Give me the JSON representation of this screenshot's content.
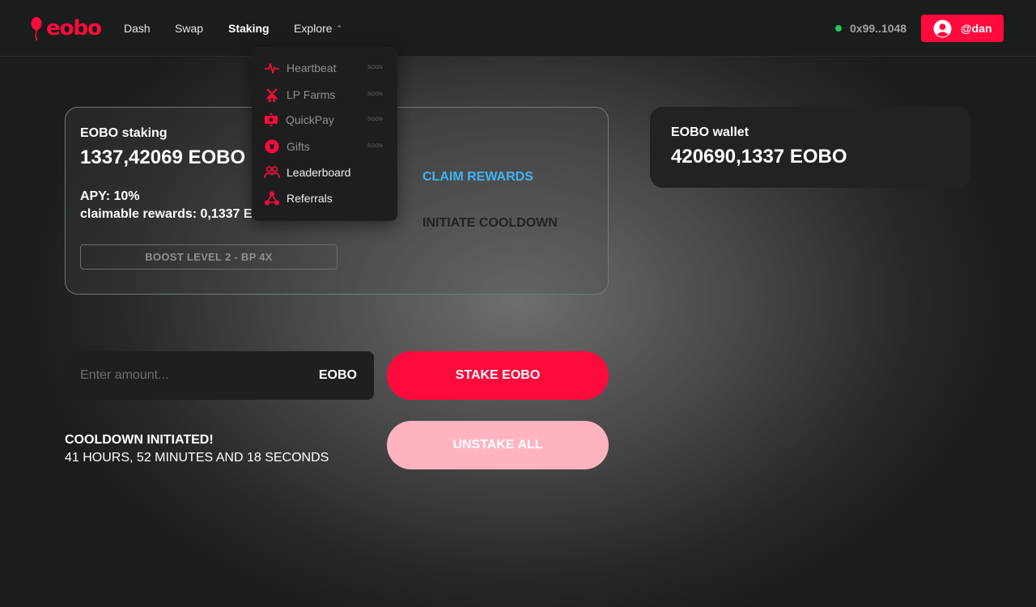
{
  "header": {
    "logo_text": "eobo",
    "nav": [
      {
        "label": "Dash",
        "active": false
      },
      {
        "label": "Swap",
        "active": false
      },
      {
        "label": "Staking",
        "active": true
      },
      {
        "label": "Explore",
        "active": false
      }
    ],
    "wallet_address": "0x99..1048",
    "connection_status_color": "#22c55e",
    "username": "@dan"
  },
  "explore_menu": {
    "items": [
      {
        "label": "Heartbeat",
        "badge": "SOON",
        "icon": "heartbeat-icon"
      },
      {
        "label": "LP Farms",
        "badge": "SOON",
        "icon": "windmill-icon"
      },
      {
        "label": "QuickPay",
        "badge": "SOON",
        "icon": "quickpay-icon"
      },
      {
        "label": "Gifts",
        "badge": "SOON",
        "icon": "gift-icon"
      },
      {
        "label": "Leaderboard",
        "badge": "",
        "icon": "users-icon"
      },
      {
        "label": "Referrals",
        "badge": "",
        "icon": "referral-network-icon"
      }
    ]
  },
  "staking_card": {
    "label": "EOBO staking",
    "amount": "1337,42069 EOBO",
    "apy": "APY: 10%",
    "claimable": "claimable rewards: 0,1337 EOBO",
    "boost": "BOOST LEVEL 2 - BP 4X",
    "claim_label": "CLAIM REWARDS",
    "cooldown_label": "INITIATE COOLDOWN"
  },
  "wallet_card": {
    "label": "EOBO wallet",
    "amount": "420690,1337 EOBO"
  },
  "amount_input": {
    "placeholder": "Enter amount...",
    "value": "",
    "unit": "EOBO"
  },
  "actions": {
    "stake": "STAKE EOBO",
    "unstake": "UNSTAKE ALL"
  },
  "cooldown": {
    "title": "COOLDOWN INITIATED!",
    "remaining": "41 HOURS, 52 MINUTES AND 18 SECONDS"
  },
  "colors": {
    "brand": "#ff0a3c",
    "link": "#3eb6f5",
    "unstake_disabled": "#ffb3c1"
  }
}
